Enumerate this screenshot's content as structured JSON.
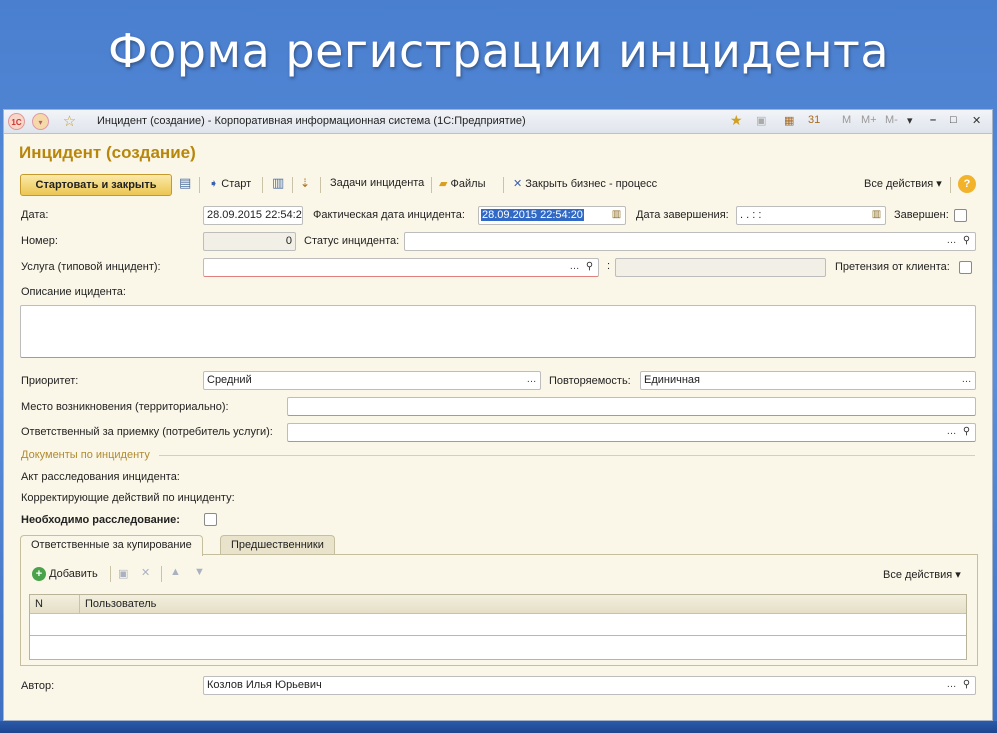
{
  "slide": {
    "title": "Форма регистрации инцидента"
  },
  "window": {
    "title": "Инцидент (создание) - Корпоративная информационная система  (1С:Предприятие)",
    "controls": {
      "m": "M",
      "mplus": "M+",
      "mminus": "M-"
    }
  },
  "form": {
    "title": "Инцидент (создание)",
    "toolbar": {
      "start_close": "Стартовать и закрыть",
      "start": "Старт",
      "tasks": "Задачи инцидента",
      "files": "Файлы",
      "close_process": "Закрыть бизнес - процесс",
      "all_actions": "Все действия",
      "help": "?"
    },
    "date": {
      "label": "Дата:",
      "value": "28.09.2015 22:54:2"
    },
    "actual_date": {
      "label": "Фактическая дата инцидента:",
      "value": "28.09.2015 22:54:20"
    },
    "end_date": {
      "label": "Дата завершения:",
      "value": " .  .      :  :"
    },
    "completed": {
      "label": "Завершен:"
    },
    "number": {
      "label": "Номер:",
      "value": "0"
    },
    "status": {
      "label": "Статус инцидента:",
      "value": ""
    },
    "service": {
      "label": "Услуга (типовой инцидент):",
      "value": "",
      "colon": ":"
    },
    "claim": {
      "label": "Претензия от клиента:"
    },
    "description": {
      "label": "Описание ицидента:"
    },
    "priority": {
      "label": "Приоритет:",
      "value": "Средний"
    },
    "repeat": {
      "label": "Повторяемость:",
      "value": "Единичная"
    },
    "location": {
      "label": "Место возникновения (территориально):"
    },
    "responsible": {
      "label": "Ответственный за приемку (потребитель услуги):"
    },
    "docs": {
      "group": "Документы по инциденту",
      "act": "Акт расследования инцидента:",
      "corrective": "Корректирующие действий по инциденту:"
    },
    "investigation": {
      "label": "Необходимо расследование:"
    },
    "tabs": [
      "Ответственные за купирование",
      "Предшественники"
    ],
    "table": {
      "add": "Добавить",
      "all_actions": "Все действия",
      "columns": [
        "N",
        "Пользователь"
      ]
    },
    "author": {
      "label": "Автор:",
      "value": "Козлов Илья Юрьевич"
    }
  },
  "colors": {
    "accent": "#b8860b",
    "background": "#fbf7e8",
    "selection": "#3169c6"
  }
}
